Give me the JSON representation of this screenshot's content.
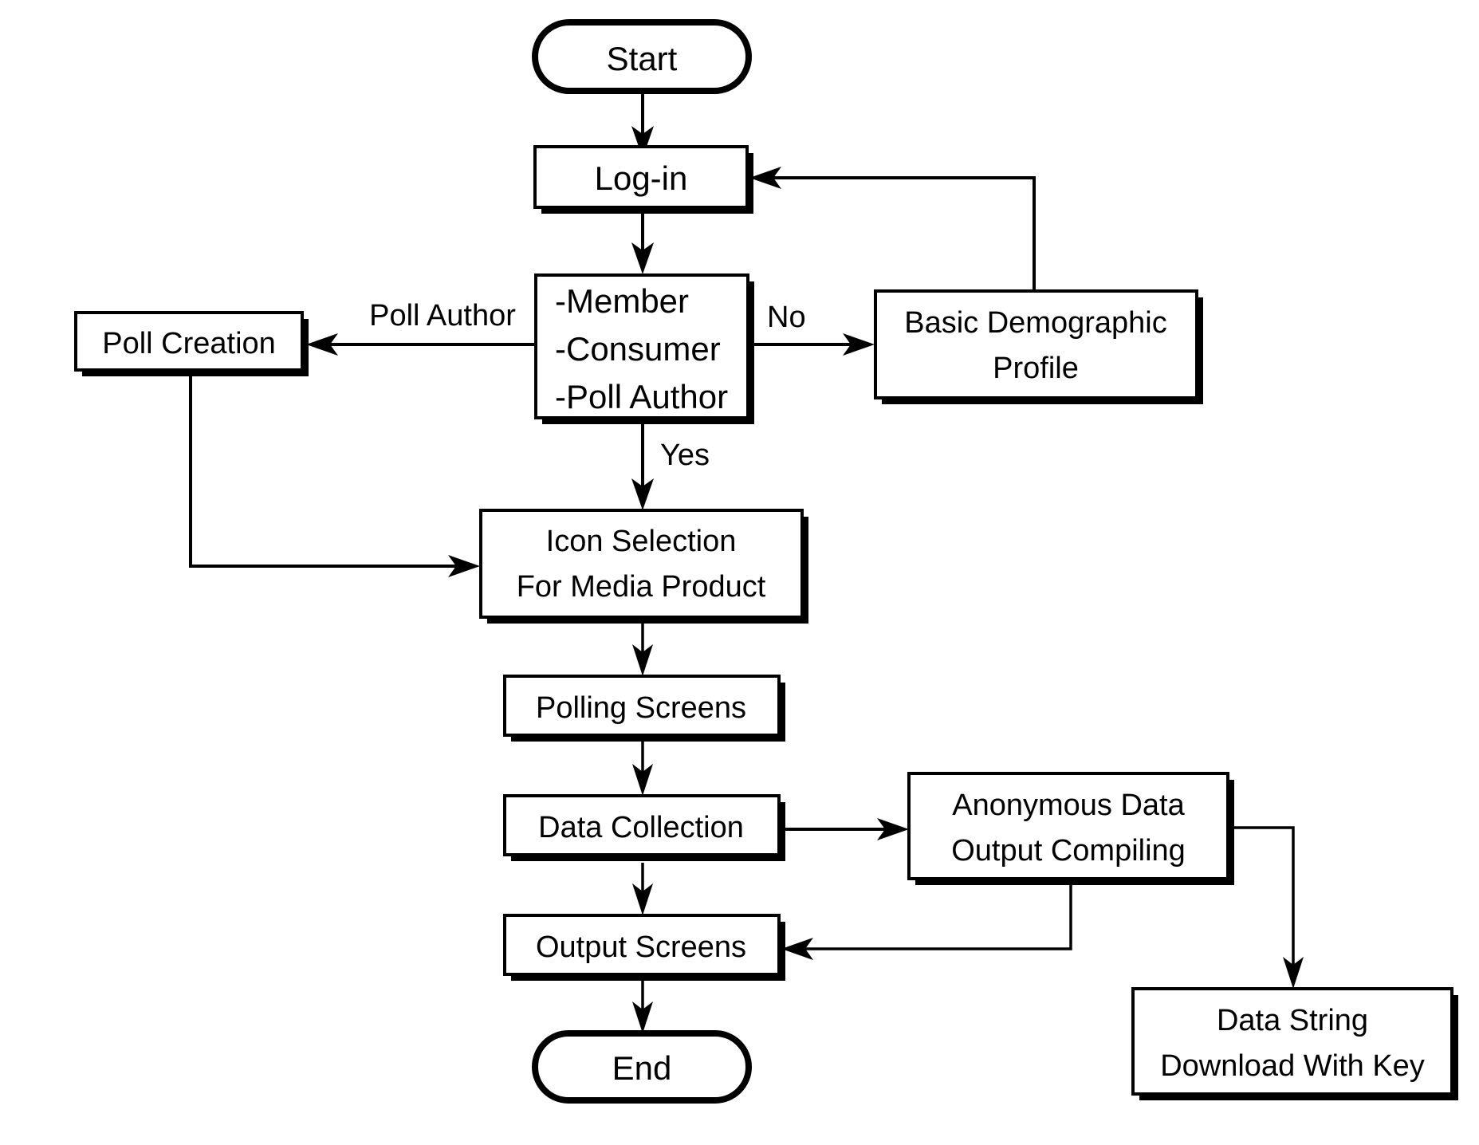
{
  "diagram": {
    "type": "flowchart",
    "title": "Polling System Process Flowchart",
    "background_color": "#ffffff",
    "line_color": "#000000",
    "nodes": [
      {
        "id": "start",
        "shape": "terminator",
        "label": "Start"
      },
      {
        "id": "login",
        "shape": "process",
        "label": "Log-in"
      },
      {
        "id": "roles",
        "shape": "process",
        "lines": [
          "-Member",
          "-Consumer",
          "-Poll Author"
        ],
        "align": "left"
      },
      {
        "id": "pollcreate",
        "shape": "process",
        "label": "Poll Creation"
      },
      {
        "id": "demo",
        "shape": "process",
        "lines": [
          "Basic Demographic",
          "Profile"
        ]
      },
      {
        "id": "icon",
        "shape": "process",
        "lines": [
          "Icon Selection",
          "For Media Product"
        ]
      },
      {
        "id": "polling",
        "shape": "process",
        "label": "Polling Screens"
      },
      {
        "id": "datacoll",
        "shape": "process",
        "label": "Data Collection"
      },
      {
        "id": "anon",
        "shape": "process",
        "lines": [
          "Anonymous Data",
          "Output Compiling"
        ]
      },
      {
        "id": "output",
        "shape": "process",
        "label": "Output Screens"
      },
      {
        "id": "datastring",
        "shape": "process",
        "lines": [
          "Data String",
          "Download With Key"
        ]
      },
      {
        "id": "end",
        "shape": "terminator",
        "label": "End"
      }
    ],
    "edges": [
      {
        "from": "start",
        "to": "login",
        "label": ""
      },
      {
        "from": "login",
        "to": "roles",
        "label": ""
      },
      {
        "from": "roles",
        "to": "pollcreate",
        "label": "Poll Author"
      },
      {
        "from": "roles",
        "to": "demo",
        "label": "No"
      },
      {
        "from": "roles",
        "to": "icon",
        "label": "Yes"
      },
      {
        "from": "demo",
        "to": "login",
        "label": ""
      },
      {
        "from": "pollcreate",
        "to": "icon",
        "label": ""
      },
      {
        "from": "icon",
        "to": "polling",
        "label": ""
      },
      {
        "from": "polling",
        "to": "datacoll",
        "label": ""
      },
      {
        "from": "datacoll",
        "to": "anon",
        "label": ""
      },
      {
        "from": "datacoll",
        "to": "output",
        "label": ""
      },
      {
        "from": "anon",
        "to": "output",
        "label": ""
      },
      {
        "from": "anon",
        "to": "datastring",
        "label": ""
      },
      {
        "from": "output",
        "to": "end",
        "label": ""
      }
    ],
    "labels": {
      "start": "Start",
      "login": "Log-in",
      "roles_line1": "-Member",
      "roles_line2": "-Consumer",
      "roles_line3": "-Poll Author",
      "pollcreate": "Poll Creation",
      "demo_line1": "Basic Demographic",
      "demo_line2": "Profile",
      "icon_line1": "Icon Selection",
      "icon_line2": "For Media Product",
      "polling": "Polling Screens",
      "datacoll": "Data Collection",
      "anon_line1": "Anonymous Data",
      "anon_line2": "Output Compiling",
      "output": "Output Screens",
      "datastring_line1": "Data String",
      "datastring_line2": "Download With Key",
      "end": "End",
      "edge_poll_author": "Poll Author",
      "edge_no": "No",
      "edge_yes": "Yes"
    }
  }
}
